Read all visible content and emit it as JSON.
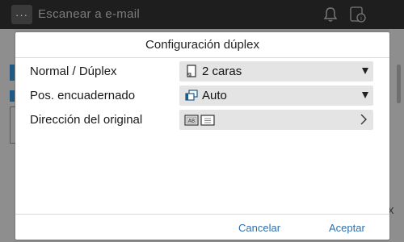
{
  "header": {
    "menu_label": "···",
    "title": "Escanear a e-mail",
    "icons": [
      "bell-icon",
      "phone-info-icon"
    ]
  },
  "dialog": {
    "title": "Configuración dúplex",
    "rows": [
      {
        "label": "Normal / Dúplex",
        "value": "2 caras",
        "icon": "two-sided-page-icon",
        "control": "dropdown"
      },
      {
        "label": "Pos. encuadernado",
        "value": "Auto",
        "icon": "binding-position-icon",
        "control": "dropdown"
      },
      {
        "label": "Dirección del original",
        "value": "",
        "icon": "original-direction-icons",
        "control": "chevron"
      }
    ],
    "cancel_label": "Cancelar",
    "accept_label": "Aceptar"
  },
  "background": {
    "close_label": "x"
  },
  "colors": {
    "accent": "#2a6fb0",
    "select_bg": "#e4e4e4",
    "overlay": "#7d7d7d"
  }
}
